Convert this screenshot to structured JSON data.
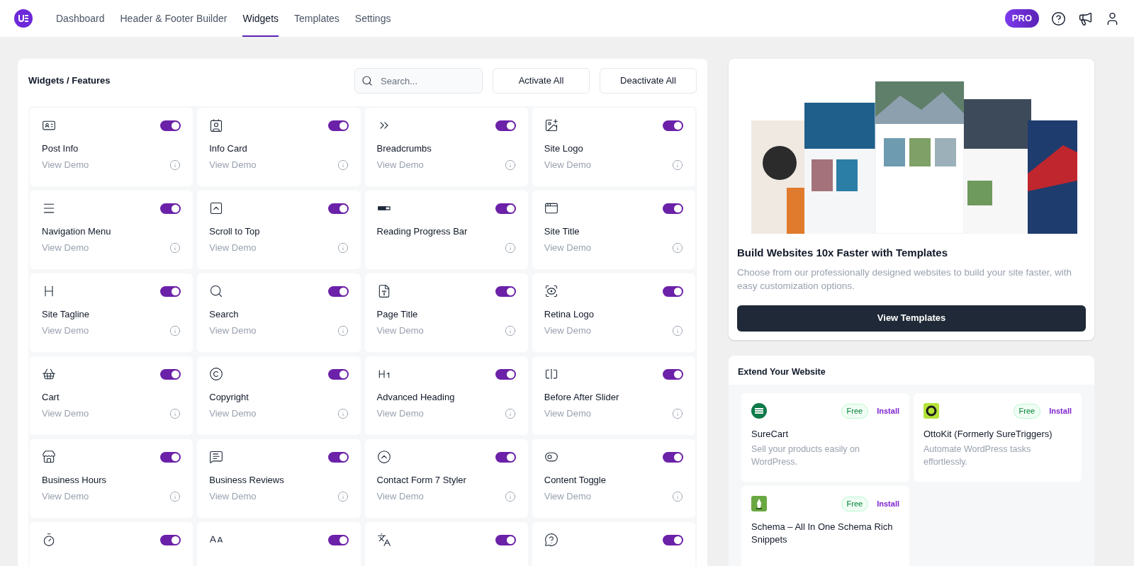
{
  "nav": {
    "tabs": [
      {
        "label": "Dashboard",
        "selected": false
      },
      {
        "label": "Header & Footer Builder",
        "selected": false
      },
      {
        "label": "Widgets",
        "selected": true
      },
      {
        "label": "Templates",
        "selected": false
      },
      {
        "label": "Settings",
        "selected": false
      }
    ],
    "badge": "PRO"
  },
  "widgets": {
    "title": "Widgets / Features",
    "search": {
      "placeholder": "Search..."
    },
    "buttons": [
      "Activate All",
      "Deactivate All"
    ],
    "items": [
      {
        "name": "Post Info",
        "demo": "View Demo",
        "enabled": true
      },
      {
        "name": "Info Card",
        "demo": "View Demo",
        "enabled": true
      },
      {
        "name": "Breadcrumbs",
        "demo": "View Demo",
        "enabled": true
      },
      {
        "name": "Site Logo",
        "demo": "View Demo",
        "enabled": true
      },
      {
        "name": "Navigation Menu",
        "demo": "View Demo",
        "enabled": true
      },
      {
        "name": "Scroll to Top",
        "demo": "View Demo",
        "enabled": true
      },
      {
        "name": "Reading Progress Bar",
        "enabled": true
      },
      {
        "name": "Site Title",
        "demo": "View Demo",
        "enabled": true
      },
      {
        "name": "Site Tagline",
        "demo": "View Demo",
        "enabled": true
      },
      {
        "name": "Search",
        "demo": "View Demo",
        "enabled": true
      },
      {
        "name": "Page Title",
        "demo": "View Demo",
        "enabled": true
      },
      {
        "name": "Retina Logo",
        "demo": "View Demo",
        "enabled": true
      },
      {
        "name": "Cart",
        "demo": "View Demo",
        "enabled": true
      },
      {
        "name": "Copyright",
        "demo": "View Demo",
        "enabled": true
      },
      {
        "name": "Advanced Heading",
        "demo": "View Demo",
        "enabled": true
      },
      {
        "name": "Before After Slider",
        "demo": "View Demo",
        "enabled": true
      },
      {
        "name": "Business Hours",
        "demo": "View Demo",
        "enabled": true
      },
      {
        "name": "Business Reviews",
        "demo": "View Demo",
        "enabled": true
      },
      {
        "name": "Contact Form 7 Styler",
        "demo": "View Demo",
        "enabled": true
      },
      {
        "name": "Content Toggle",
        "demo": "View Demo",
        "enabled": true
      },
      {
        "enabled": true
      },
      {
        "enabled": true
      },
      {
        "enabled": true
      },
      {
        "enabled": true
      }
    ]
  },
  "templates": {
    "kind": "picture",
    "title": "Build Websites 10x Faster with Templates",
    "description": "Choose from our professionally designed websites to build your site faster, with easy customization options.",
    "button": "View Templates"
  },
  "extend": {
    "title": "Extend Your Website",
    "plugins": [
      {
        "badge": "Free",
        "action": "Install",
        "name": "SureCart",
        "description": "Sell your products easily on WordPress."
      },
      {
        "badge": "Free",
        "action": "Install",
        "name": "OttoKit (Formerly SureTriggers)",
        "description": "Automate WordPress tasks effortlessly."
      },
      {
        "badge": "Free",
        "action": "Install",
        "name": "Schema – All In One Schema Rich Snippets"
      }
    ]
  }
}
